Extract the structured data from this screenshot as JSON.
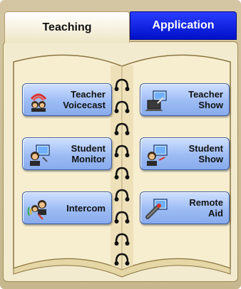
{
  "tabs": [
    {
      "label": "Teaching",
      "active": true
    },
    {
      "label": "Application",
      "active": false
    }
  ],
  "buttons": [
    {
      "label": "Teacher\nVoicecast",
      "icon": "teacher-voicecast-icon"
    },
    {
      "label": "Teacher\nShow",
      "icon": "teacher-show-icon"
    },
    {
      "label": "Student\nMonitor",
      "icon": "student-monitor-icon"
    },
    {
      "label": "Student\nShow",
      "icon": "student-show-icon"
    },
    {
      "label": "Intercom",
      "icon": "intercom-icon"
    },
    {
      "label": "Remote\nAid",
      "icon": "remote-aid-icon"
    }
  ],
  "colors": {
    "active_tab": "#ffffff",
    "inactive_tab": "#0a1ee6",
    "button": "#9dbcf4",
    "page": "#f2ebcf"
  }
}
